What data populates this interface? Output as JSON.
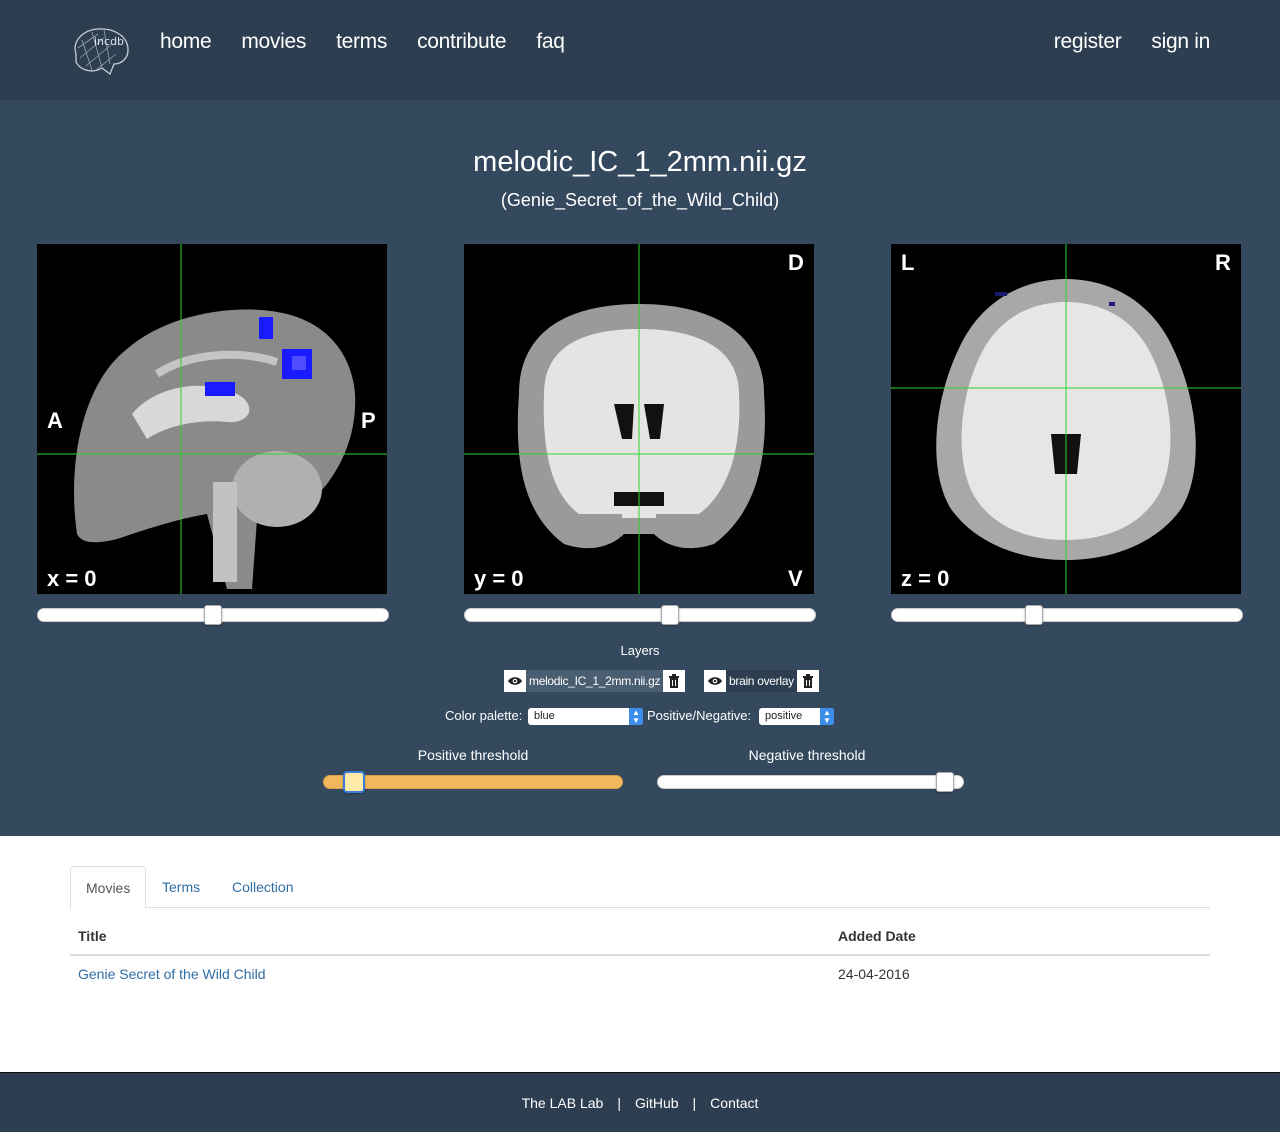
{
  "nav": {
    "logo_text": "incdb",
    "left": [
      "home",
      "movies",
      "terms",
      "contribute",
      "faq"
    ],
    "right": [
      "register",
      "sign in"
    ]
  },
  "viewer": {
    "title": "melodic_IC_1_2mm.nii.gz",
    "subtitle": "(Genie_Secret_of_the_Wild_Child)",
    "sagittal": {
      "coord": "x = 0",
      "left": "A",
      "right": "P",
      "slider_value": 0.5
    },
    "coronal": {
      "coord": "y = 0",
      "top": "D",
      "bottom": "V",
      "slider_value": 0.59
    },
    "axial": {
      "coord": "z = 0",
      "left": "L",
      "right": "R",
      "slider_value": 0.4
    },
    "layers_label": "Layers",
    "layers": [
      {
        "name": "melodic_IC_1_2mm.nii.gz",
        "visible": true
      },
      {
        "name": "brain overlay",
        "visible": true
      }
    ],
    "color_palette_label": "Color palette:",
    "color_palette_value": "blue",
    "posneg_label": "Positive/Negative:",
    "posneg_value": "positive",
    "positive_threshold_label": "Positive threshold",
    "positive_threshold_value": 0.07,
    "negative_threshold_label": "Negative threshold",
    "negative_threshold_value": 0.97,
    "colors": {
      "overlay": "#1a1aff",
      "crosshair": "#2bd62b",
      "slider_fill": "#f0b85a"
    }
  },
  "tabs": [
    "Movies",
    "Terms",
    "Collection"
  ],
  "table": {
    "headers": [
      "Title",
      "Added Date"
    ],
    "rows": [
      {
        "title": "Genie Secret of the Wild Child",
        "date": "24-04-2016"
      }
    ]
  },
  "footer": {
    "links": [
      "The LAB Lab",
      "GitHub",
      "Contact"
    ],
    "separator": "|"
  }
}
